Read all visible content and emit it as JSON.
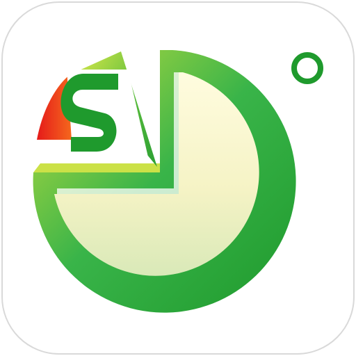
{
  "app_icon": {
    "name": "pie-chart-app-icon",
    "logo_letter": "S",
    "colors": {
      "background": "#ffffff",
      "border": "#d9d9d9",
      "green_dark": "#1f9a2d",
      "green_mid": "#39b449",
      "green_light": "#c8df3d",
      "cream": "#fffcdf",
      "cream_mid": "#f5f3c5",
      "light_green_fill": "#d9e9b8",
      "orange": "#ff9a1f",
      "red": "#e51a1a",
      "yellow": "#ffe11a"
    }
  }
}
